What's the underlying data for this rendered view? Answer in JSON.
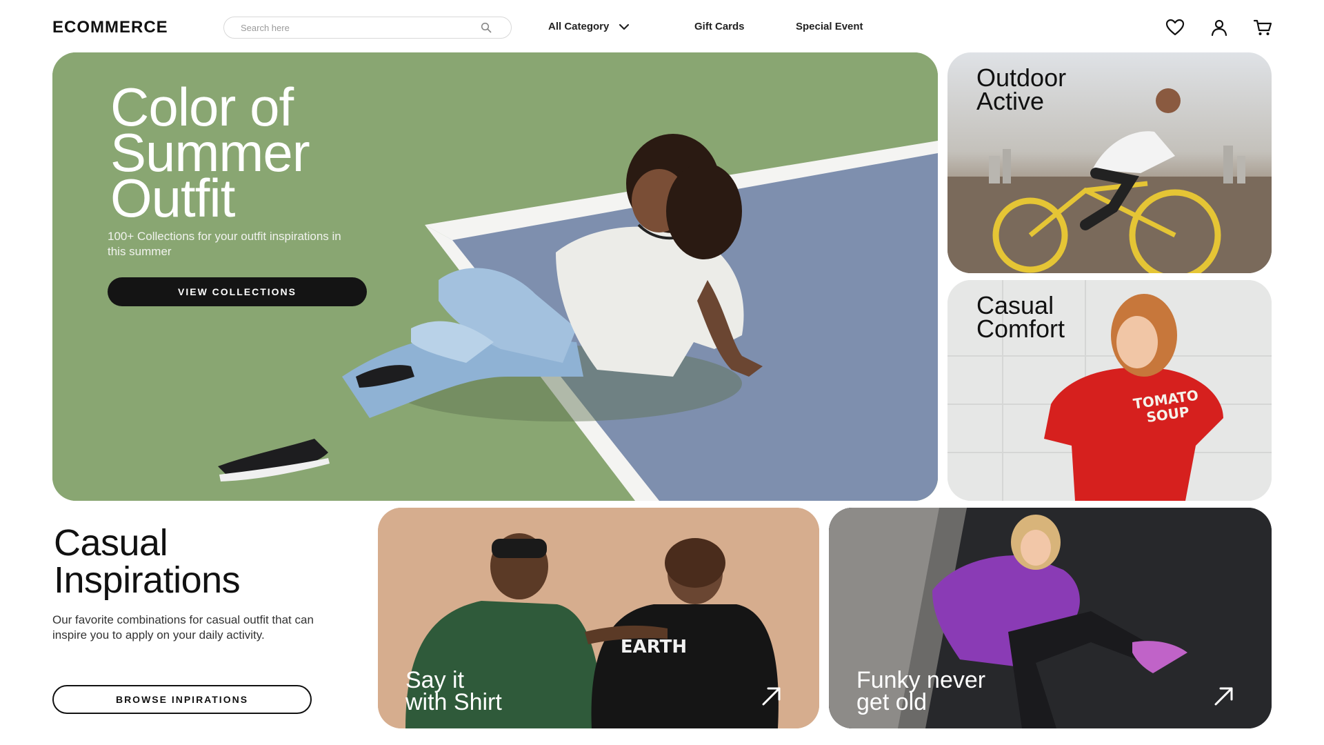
{
  "header": {
    "logo": "ECOMMERCE",
    "search_placeholder": "Search here",
    "search_icon": "search-icon",
    "nav": {
      "category": "All Category",
      "gift_cards": "Gift Cards",
      "special_event": "Special Event"
    },
    "icons": [
      "heart-icon",
      "user-icon",
      "cart-icon"
    ]
  },
  "hero": {
    "title": "Color of\nSummer\nOutfit",
    "subtitle": "100+ Collections for your outfit inspirations in this summer",
    "button": "VIEW COLLECTIONS"
  },
  "tiles": {
    "outdoor": {
      "title": "Outdoor\nActive"
    },
    "casual": {
      "title": "Casual\nComfort",
      "shirt_print": "TOMATO SOUP"
    },
    "shirt": {
      "caption": "Say it\nwith Shirt"
    },
    "funky": {
      "caption": "Funky never\nget old"
    }
  },
  "inspirations": {
    "title": "Casual\nInspirations",
    "body": "Our favorite combinations for casual outfit that can inspire you to apply on your daily activity.",
    "button": "BROWSE INPIRATIONS"
  },
  "colors": {
    "hero_green": "#89a672",
    "court_blue": "#7e8fae",
    "dark_button": "#141414",
    "text_dark": "#111111"
  }
}
